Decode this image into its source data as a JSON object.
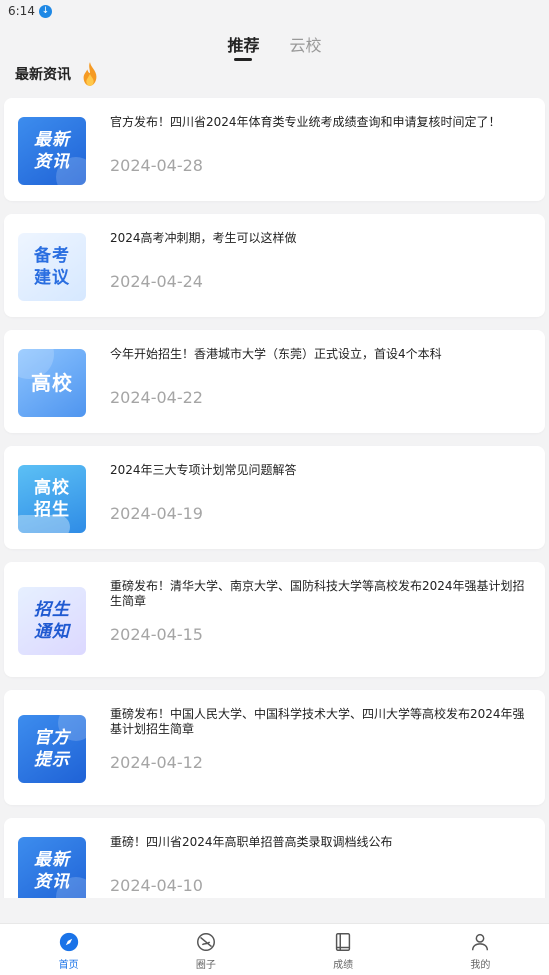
{
  "status_bar": {
    "time": "6:14"
  },
  "tabs": [
    {
      "label": "推荐",
      "active": true
    },
    {
      "label": "云校",
      "active": false
    }
  ],
  "section": {
    "title": "最新资讯"
  },
  "news": [
    {
      "thumb_text": "最新资讯",
      "title": "官方发布！四川省2024年体育类专业统考成绩查询和申请复核时间定了！",
      "date": "2024-04-28"
    },
    {
      "thumb_text": "备考建议",
      "title": "2024高考冲刺期，考生可以这样做",
      "date": "2024-04-24"
    },
    {
      "thumb_text": "高校",
      "title": "今年开始招生！香港城市大学（东莞）正式设立，首设4个本科",
      "date": "2024-04-22"
    },
    {
      "thumb_text": "高校招生",
      "title": "2024年三大专项计划常见问题解答",
      "date": "2024-04-19"
    },
    {
      "thumb_text": "招生通知",
      "title": "重磅发布！清华大学、南京大学、国防科技大学等高校发布2024年强基计划招生简章",
      "date": "2024-04-15"
    },
    {
      "thumb_text": "官方提示",
      "title": "重磅发布！中国人民大学、中国科学技术大学、四川大学等高校发布2024年强基计划招生简章",
      "date": "2024-04-12"
    },
    {
      "thumb_text": "最新资讯",
      "title": "重磅！四川省2024年高职单招普高类录取调档线公布",
      "date": "2024-04-10"
    }
  ],
  "bottom_nav": [
    {
      "label": "首页",
      "icon": "compass-icon",
      "active": true
    },
    {
      "label": "圈子",
      "icon": "circle-icon",
      "active": false
    },
    {
      "label": "成绩",
      "icon": "book-icon",
      "active": false
    },
    {
      "label": "我的",
      "icon": "person-icon",
      "active": false
    }
  ],
  "colors": {
    "accent": "#1a73e8",
    "date_gray": "#a5a5a5"
  }
}
